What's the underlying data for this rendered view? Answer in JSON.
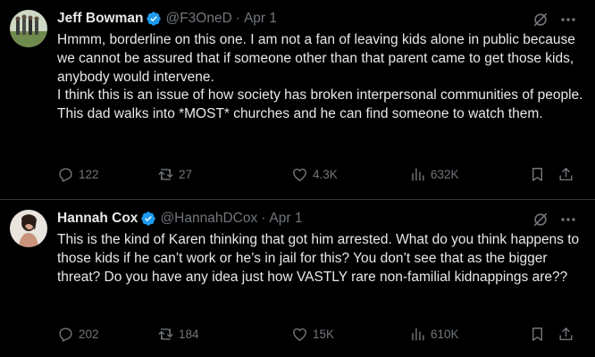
{
  "tweets": [
    {
      "display_name": "Jeff Bowman",
      "handle": "@F3OneD",
      "separator": "·",
      "date": "Apr 1",
      "body_lines": [
        "Hmmm, borderline on this one. I am not a fan of leaving kids alone in public because we cannot be assured that if someone other than that parent came to get those kids, anybody would intervene.",
        "I think this is an issue of how society has broken interpersonal communities of people. This dad walks into *MOST* churches and he can find someone to watch them."
      ],
      "replies": "122",
      "reposts": "27",
      "likes": "4.3K",
      "views": "632K"
    },
    {
      "display_name": "Hannah Cox",
      "handle": "@HannahDCox",
      "separator": "·",
      "date": "Apr 1",
      "body_lines": [
        "This is the kind of Karen thinking that got him arrested. What do you think happens to those kids if he can’t work or he’s in jail for this? You don’t see that as the bigger threat? Do you have any idea just how VASTLY rare non-familial kidnappings are??"
      ],
      "replies": "202",
      "reposts": "184",
      "likes": "15K",
      "views": "610K"
    }
  ],
  "colors": {
    "background": "#000000",
    "text_primary": "#e7e9ea",
    "text_secondary": "#71767b",
    "verified_badge": "#1d9bf0",
    "divider": "#2f3336"
  },
  "icons": [
    "verified-badge-icon",
    "grok-icon",
    "more-icon",
    "reply-icon",
    "repost-icon",
    "like-icon",
    "views-icon",
    "bookmark-icon",
    "share-icon"
  ]
}
